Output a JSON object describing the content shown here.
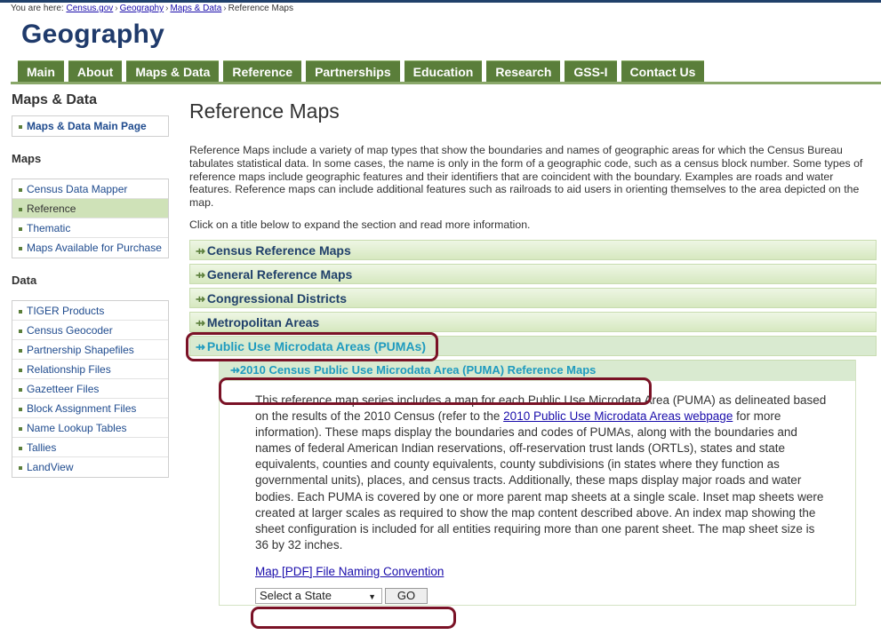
{
  "breadcrumb": {
    "prefix": "You are here:",
    "links": [
      "Census.gov",
      "Geography",
      "Maps & Data"
    ],
    "separator": "›",
    "current": "Reference Maps"
  },
  "site_title": "Geography",
  "nav": {
    "tabs": [
      "Main",
      "About",
      "Maps & Data",
      "Reference",
      "Partnerships",
      "Education",
      "Research",
      "GSS-I",
      "Contact Us"
    ]
  },
  "sidebar": {
    "heading": "Maps & Data",
    "main_link": "Maps & Data Main Page",
    "maps_heading": "Maps",
    "maps_items": [
      {
        "label": "Census Data Mapper",
        "active": false
      },
      {
        "label": "Reference",
        "active": true
      },
      {
        "label": "Thematic",
        "active": false
      },
      {
        "label": "Maps Available for Purchase",
        "active": false
      }
    ],
    "data_heading": "Data",
    "data_items": [
      "TIGER Products",
      "Census Geocoder",
      "Partnership Shapefiles",
      "Relationship Files",
      "Gazetteer Files",
      "Block Assignment Files",
      "Name Lookup Tables",
      "Tallies",
      "LandView"
    ]
  },
  "content": {
    "title": "Reference Maps",
    "intro": "Reference Maps include a variety of map types that show the boundaries and names of geographic areas for which the Census Bureau tabulates statistical data. In some cases, the name is only in the form of a geographic code, such as a census block number. Some types of reference maps include geographic features and their identifiers that are coincident with the boundary. Examples are roads and water features. Reference maps can include additional features such as railroads to aid users in orienting themselves to the area depicted on the map.",
    "instruction": "Click on a title below to expand the section and read more information.",
    "sections": [
      {
        "label": "Census Reference Maps",
        "icon": "expand-arrow-icon"
      },
      {
        "label": "General Reference Maps",
        "icon": "expand-arrow-icon"
      },
      {
        "label": "Congressional Districts",
        "icon": "expand-arrow-icon"
      },
      {
        "label": "Metropolitan Areas",
        "icon": "expand-arrow-icon"
      }
    ],
    "open_section": "Public Use Microdata Areas (PUMAs)",
    "subsection": {
      "title": "2010 Census Public Use Microdata Area (PUMA) Reference Maps",
      "body_before_link": "This reference map series includes a map for each Public Use Microdata Area (PUMA) as delineated based on the results of the 2010 Census (refer to the ",
      "body_link": "2010 Public Use Microdata Areas webpage",
      "body_after_link": " for more information). These maps display the boundaries and codes of PUMAs, along with the boundaries and names of federal American Indian reservations, off-reservation trust lands (ORTLs), states and state equivalents, counties and county equivalents, county subdivisions (in states where they function as governmental units), places, and census tracts. Additionally, these maps display major roads and water bodies. Each PUMA is covered by one or more parent map sheets at a single scale. Inset map sheets were created at larger scales as required to show the map content described above. An index map showing the sheet configuration is included for all entities requiring more than one parent sheet. The map sheet size is 36 by 32 inches.",
      "file_link": "Map [PDF] File Naming Convention",
      "select_value": "Select a State",
      "go_label": "GO"
    }
  },
  "colors": {
    "nav_green": "#5a7e3a",
    "title_blue": "#1f3a6b",
    "highlight": "#7a1226",
    "open_text": "#1f9bbf"
  }
}
